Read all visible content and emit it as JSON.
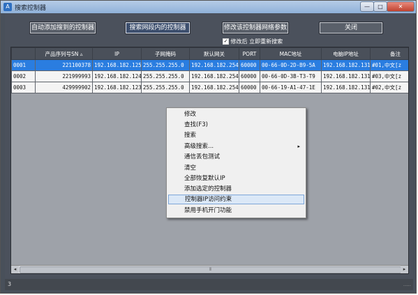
{
  "window": {
    "title": "搜索控制器",
    "minimize": "—",
    "maximize": "□",
    "close": "✕"
  },
  "toolbar": {
    "auto_add": "自动添加搜到的控制器",
    "search_lan": "搜索网段内的控制器",
    "modify_network": "修改该控制器网络参数",
    "close": "关闭",
    "research_after_modify": "修改后 立即重新搜索",
    "research_checked": true
  },
  "table": {
    "columns": [
      "",
      "产品序列号SN",
      "IP",
      "子网掩码",
      "默认网关",
      "PORT",
      "MAC地址",
      "电脑IP地址",
      "备注"
    ],
    "sort_indicator": "▵",
    "rows": [
      [
        "0001",
        "221100378",
        "192.168.182.125",
        "255.255.255.0",
        "192.168.182.254",
        "60000",
        "00-66-0D-2D-B9-5A",
        "192.168.182.131",
        "#01,中文[z"
      ],
      [
        "0002",
        "221999993",
        "192.168.182.124",
        "255.255.255.0",
        "192.168.182.254",
        "60000",
        "00-66-0D-3B-T3-T9",
        "192.168.182.131",
        "#03,中文[z"
      ],
      [
        "0003",
        "429999902",
        "192.168.182.123",
        "255.255.255.0",
        "192.168.182.254",
        "60000",
        "00-66-19-A1-47-1E",
        "192.168.182.131",
        "#02,中文[z"
      ]
    ],
    "selected_row": 0
  },
  "context_menu": {
    "items": [
      "修改",
      "查找(F3)",
      "搜索",
      "高级搜索...",
      "通信丢包测试",
      "清空",
      "全部恢复默认IP",
      "添加选定的控制器",
      "控制器IP访问约束",
      "禁用手机开门功能"
    ],
    "submenu_index": 3,
    "highlighted_index": 8
  },
  "scrollbar": {
    "left": "◂",
    "right": "▸",
    "thumb": "⦀"
  },
  "status": {
    "count": "3",
    "grip": "....."
  },
  "icons": {
    "app": "A",
    "submenu": "▸",
    "check": "✓"
  }
}
